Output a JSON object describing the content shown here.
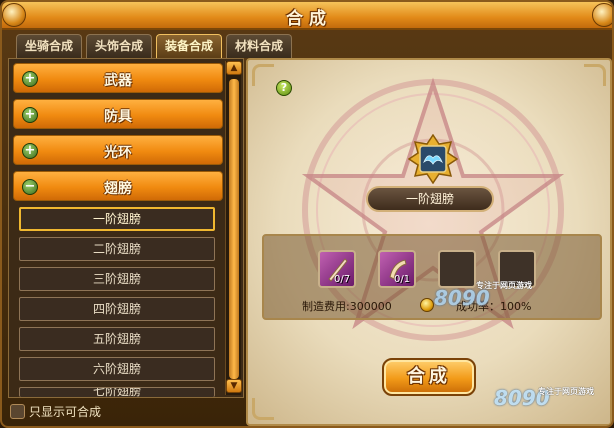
{
  "window": {
    "title": "合成"
  },
  "tabs": [
    {
      "label": "坐骑合成",
      "active": false
    },
    {
      "label": "头饰合成",
      "active": false
    },
    {
      "label": "装备合成",
      "active": true
    },
    {
      "label": "材料合成",
      "active": false
    }
  ],
  "categories": [
    {
      "label": "武器",
      "expanded": false,
      "icon": "plus"
    },
    {
      "label": "防具",
      "expanded": false,
      "icon": "plus"
    },
    {
      "label": "光环",
      "expanded": false,
      "icon": "plus"
    },
    {
      "label": "翅膀",
      "expanded": true,
      "icon": "minus"
    }
  ],
  "wing_items": [
    {
      "label": "一阶翅膀",
      "selected": true
    },
    {
      "label": "二阶翅膀",
      "selected": false
    },
    {
      "label": "三阶翅膀",
      "selected": false
    },
    {
      "label": "四阶翅膀",
      "selected": false
    },
    {
      "label": "五阶翅膀",
      "selected": false
    },
    {
      "label": "六阶翅膀",
      "selected": false
    },
    {
      "label": "七阶翅膀",
      "selected": false
    }
  ],
  "filter": {
    "label": "只显示可合成",
    "checked": false
  },
  "result": {
    "name": "一阶翅膀",
    "icon": "wing-icon"
  },
  "materials": [
    {
      "count": "0/7",
      "icon": "feather-scroll-icon"
    },
    {
      "count": "0/1",
      "icon": "scroll-icon"
    },
    {
      "count": "",
      "icon": ""
    },
    {
      "count": "",
      "icon": ""
    }
  ],
  "cost": {
    "label": "制造费用:300000",
    "currency_icon": "gold-coin-icon"
  },
  "success_rate": {
    "label": "成功率：100%"
  },
  "craft_button": {
    "label": "合成"
  },
  "help_button": {
    "label": "?"
  },
  "scroll": {
    "up": "▲",
    "down": "▼"
  },
  "watermark": {
    "brand": "8090",
    "tagline": "专注于网页游戏",
    "text": "游戏"
  },
  "colors": {
    "accent": "#f08a10",
    "panel": "#3c2a16",
    "selection": "#f0b830"
  }
}
